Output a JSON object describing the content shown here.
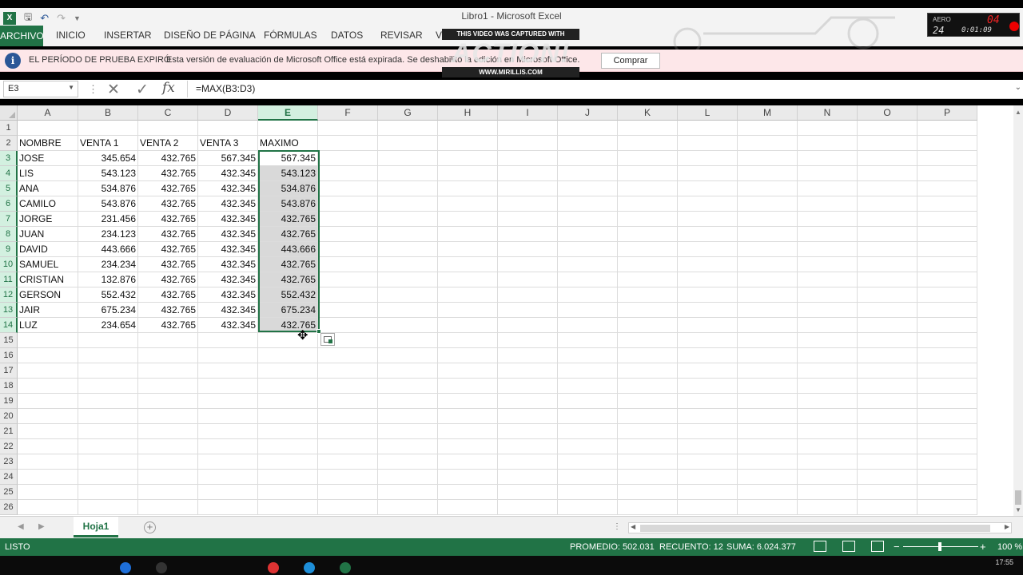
{
  "window": {
    "title": "Libro1 - Microsoft Excel"
  },
  "ribbon": {
    "file_tab": "ARCHIVO",
    "tabs": [
      "INICIO",
      "INSERTAR",
      "DISEÑO DE PÁGINA",
      "FÓRMULAS",
      "DATOS",
      "REVISAR",
      "VI"
    ]
  },
  "notice": {
    "heading": "EL PERÍODO DE PRUEBA EXPIRÓ",
    "message": "Esta versión de evaluación de Microsoft Office está expirada. Se deshabilitó la edición en Microsoft Office.",
    "button": "Comprar"
  },
  "watermark": {
    "caption": "THIS VIDEO WAS CAPTURED WITH",
    "logo": "ACTION!",
    "url": "WWW.MIRILLIS.COM"
  },
  "recorder": {
    "mode": "AERO",
    "fps_top": "04",
    "fps": "24",
    "time": "0:01:09"
  },
  "formula_bar": {
    "name_box": "E3",
    "formula": "=MAX(B3:D3)"
  },
  "sheet": {
    "columns": [
      "A",
      "B",
      "C",
      "D",
      "E",
      "F",
      "G",
      "H",
      "I",
      "J",
      "K",
      "L",
      "M",
      "N",
      "O",
      "P"
    ],
    "selected_column": "E",
    "row_numbers": [
      "1",
      "2",
      "3",
      "4",
      "5",
      "6",
      "7",
      "8",
      "9",
      "10",
      "11",
      "12",
      "13",
      "14",
      "15",
      "16",
      "17",
      "18",
      "19",
      "20",
      "21",
      "22",
      "23",
      "24",
      "25",
      "26"
    ],
    "header_row": [
      "NOMBRE",
      "VENTA 1",
      "VENTA 2",
      "VENTA 3",
      "MAXIMO"
    ],
    "rows": [
      [
        "JOSE",
        "345.654",
        "432.765",
        "567.345",
        "567.345"
      ],
      [
        "LIS",
        "543.123",
        "432.765",
        "432.345",
        "543.123"
      ],
      [
        "ANA",
        "534.876",
        "432.765",
        "432.345",
        "534.876"
      ],
      [
        "CAMILO",
        "543.876",
        "432.765",
        "432.345",
        "543.876"
      ],
      [
        "JORGE",
        "231.456",
        "432.765",
        "432.345",
        "432.765"
      ],
      [
        "JUAN",
        "234.123",
        "432.765",
        "432.345",
        "432.765"
      ],
      [
        "DAVID",
        "443.666",
        "432.765",
        "432.345",
        "443.666"
      ],
      [
        "SAMUEL",
        "234.234",
        "432.765",
        "432.345",
        "432.765"
      ],
      [
        "CRISTIAN",
        "132.876",
        "432.765",
        "432.345",
        "432.765"
      ],
      [
        "GERSON",
        "552.432",
        "432.765",
        "432.345",
        "552.432"
      ],
      [
        "JAIR",
        "675.234",
        "432.765",
        "432.345",
        "675.234"
      ],
      [
        "LUZ",
        "234.654",
        "432.765",
        "432.345",
        "432.765"
      ]
    ]
  },
  "sheet_tabs": {
    "active": "Hoja1"
  },
  "status_bar": {
    "mode": "LISTO",
    "average": "PROMEDIO: 502.031",
    "count": "RECUENTO: 12",
    "sum": "SUMA: 6.024.377",
    "zoom": "100 %"
  },
  "taskbar": {
    "clock": "17:55"
  },
  "colors": {
    "accent": "#217346",
    "notice_bg": "#fde7e9",
    "selection": "#d9d9d9"
  }
}
